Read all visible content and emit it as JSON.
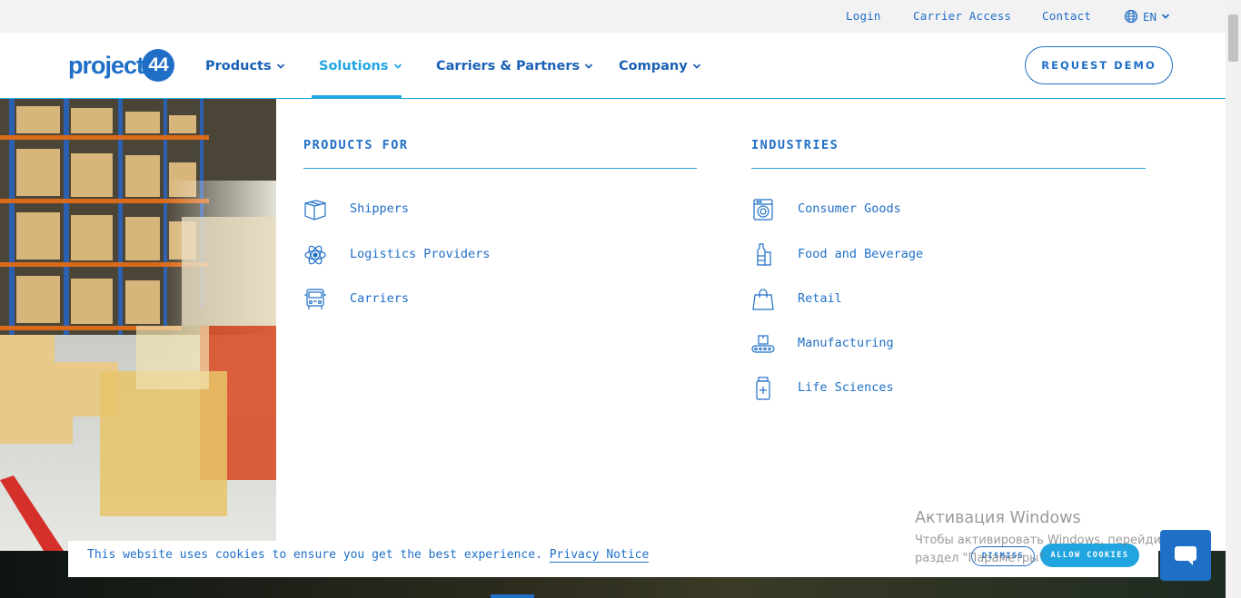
{
  "utility": {
    "login": "Login",
    "carrier_access": "Carrier Access",
    "contact": "Contact",
    "language": "EN"
  },
  "header": {
    "logo_text": "project",
    "logo_number": "44",
    "nav": [
      {
        "label": "Products",
        "active": false
      },
      {
        "label": "Solutions",
        "active": true
      },
      {
        "label": "Carriers & Partners",
        "active": false
      },
      {
        "label": "Company",
        "active": false
      }
    ],
    "cta": "REQUEST DEMO"
  },
  "menu": {
    "products_for": {
      "title": "PRODUCTS FOR",
      "items": [
        {
          "label": "Shippers",
          "icon": "box-icon"
        },
        {
          "label": "Logistics Providers",
          "icon": "atom-icon"
        },
        {
          "label": "Carriers",
          "icon": "truck-icon"
        }
      ]
    },
    "industries": {
      "title": "INDUSTRIES",
      "items": [
        {
          "label": "Consumer Goods",
          "icon": "washing-machine-icon"
        },
        {
          "label": "Food and Beverage",
          "icon": "bottles-icon"
        },
        {
          "label": "Retail",
          "icon": "shopping-bag-icon"
        },
        {
          "label": "Manufacturing",
          "icon": "conveyor-icon"
        },
        {
          "label": "Life Sciences",
          "icon": "medicine-bottle-icon"
        }
      ]
    }
  },
  "cookie": {
    "text": "This website uses cookies to ensure you get the best experience.",
    "link": "Privacy Notice",
    "dismiss": "DISMISS",
    "allow": "ALLOW COOKIES"
  },
  "watermark": {
    "title": "Активация Windows",
    "line1": "Чтобы активировать Windows, перейдите в",
    "line2": "раздел \"Параметры\"."
  },
  "colors": {
    "brand": "#1f6fc7",
    "accent": "#21a5e1"
  }
}
